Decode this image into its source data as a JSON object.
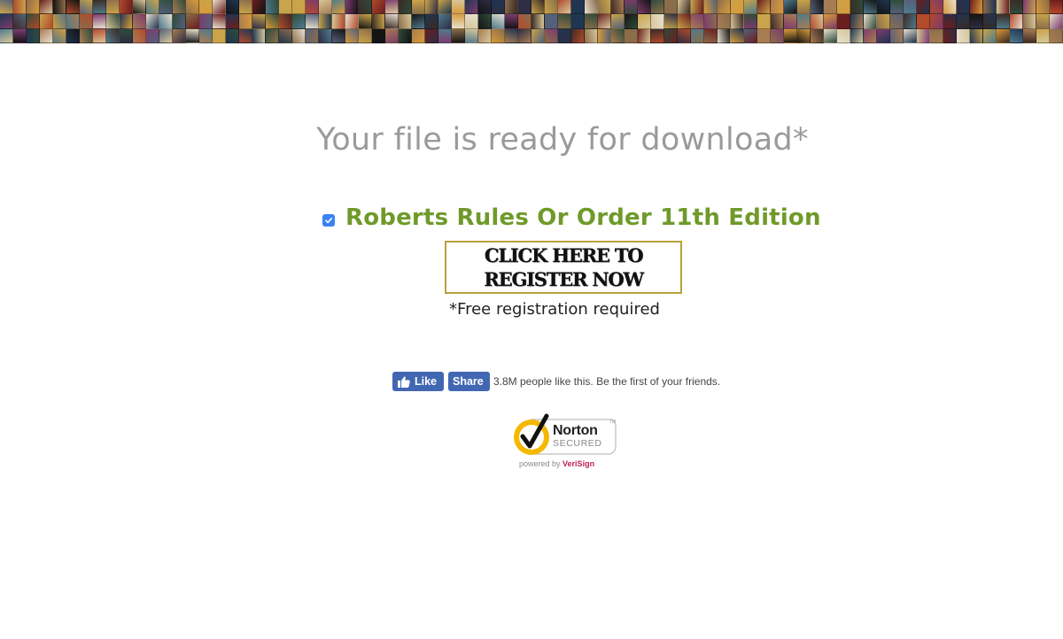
{
  "banner": {
    "icon": "movie-poster-collage",
    "colors": [
      "#3a2a24",
      "#8a6d4b",
      "#1f3552",
      "#b24a2c",
      "#d7c79a",
      "#2f4b3a",
      "#6b1e1e",
      "#c9a44a",
      "#55607a",
      "#e8e0d0",
      "#141414",
      "#7d3b6e",
      "#a87c52",
      "#2d2d44",
      "#d99a3a",
      "#4f7a8c"
    ]
  },
  "headline": "Your file is ready for download*",
  "file": {
    "title": "Roberts Rules Or Order 11th Edition",
    "checked": true,
    "checkbox_color": "#3b82f6",
    "title_color": "#6f9a2a"
  },
  "register": {
    "line1": "CLICK HERE TO",
    "line2": "REGISTER NOW"
  },
  "note": "*Free registration required",
  "social": {
    "like_label": "Like",
    "share_label": "Share",
    "text": "3.8M people like this. Be the first of your friends.",
    "fb_color": "#4267b2"
  },
  "norton": {
    "brand": "Norton",
    "secured": "SECURED",
    "powered_by": "powered by",
    "verisign": "VeriSign"
  }
}
